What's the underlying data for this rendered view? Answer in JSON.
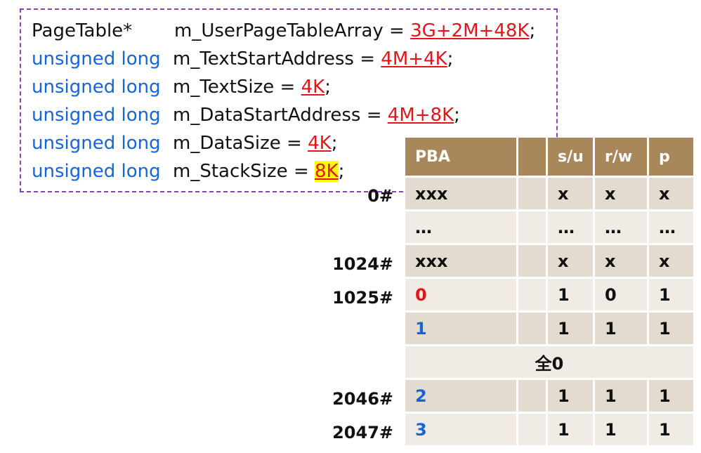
{
  "code": {
    "lines": [
      {
        "type": "PageTable*",
        "decl": "m_UserPageTableArray = ",
        "value": "3G+2M+48K",
        "highlight": false
      },
      {
        "type": "unsigned long",
        "decl": "m_TextStartAddress = ",
        "value": "4M+4K",
        "highlight": false
      },
      {
        "type": "unsigned long",
        "decl": "m_TextSize = ",
        "value": "4K",
        "highlight": false
      },
      {
        "type": "unsigned long",
        "decl": "m_DataStartAddress = ",
        "value": "4M+8K",
        "highlight": false
      },
      {
        "type": "unsigned long",
        "decl": "m_DataSize = ",
        "value": "4K",
        "highlight": false
      },
      {
        "type": "unsigned long",
        "decl": "m_StackSize = ",
        "value": "8K",
        "highlight": true
      }
    ],
    "semicolon": ";"
  },
  "page_table": {
    "headers": [
      "PBA",
      "",
      "s/u",
      "r/w",
      "p"
    ],
    "row_labels": {
      "r0": "0#",
      "r1024": "1024#",
      "r1025": "1025#",
      "r2046": "2046#",
      "r2047": "2047#"
    },
    "rows": {
      "r0": [
        "xxx",
        "",
        "x",
        "x",
        "x"
      ],
      "dots": [
        "…",
        "",
        "…",
        "…",
        "…"
      ],
      "r1024": [
        "xxx",
        "",
        "x",
        "x",
        "x"
      ],
      "r1025": [
        "0",
        "",
        "1",
        "0",
        "1"
      ],
      "r1026": [
        "1",
        "",
        "1",
        "1",
        "1"
      ],
      "zeros": "全0",
      "r2046": [
        "2",
        "",
        "1",
        "1",
        "1"
      ],
      "r2047": [
        "3",
        "",
        "1",
        "1",
        "1"
      ]
    }
  },
  "colors": {
    "type_blue": "#1565d8",
    "value_red": "#e0161b",
    "highlight": "#ffff00",
    "header_bg": "#a8885a",
    "row_dark": "#e3dad0",
    "row_light": "#f0ebe5",
    "dash_border": "#8e44ad"
  }
}
